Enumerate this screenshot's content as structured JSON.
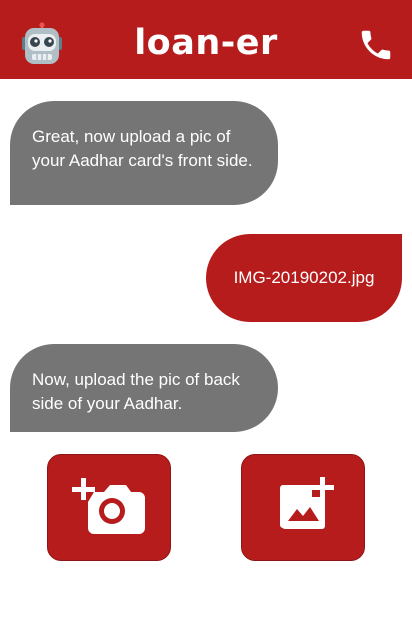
{
  "header": {
    "title": "loan-er",
    "bot_icon": "robot-face-icon",
    "call_icon": "phone-icon"
  },
  "messages": [
    {
      "sender": "bot",
      "text": "Great, now upload a pic of your Aadhar card's front side."
    },
    {
      "sender": "user",
      "text": "IMG-20190202.jpg"
    },
    {
      "sender": "bot",
      "text": "Now, upload the pic of back side of your Aadhar."
    }
  ],
  "actions": {
    "camera_icon": "add-a-photo-icon",
    "gallery_icon": "add-photo-alternate-icon"
  },
  "colors": {
    "brand": "#b71c1c",
    "bot_bubble": "#757575",
    "background": "#ffffff"
  }
}
